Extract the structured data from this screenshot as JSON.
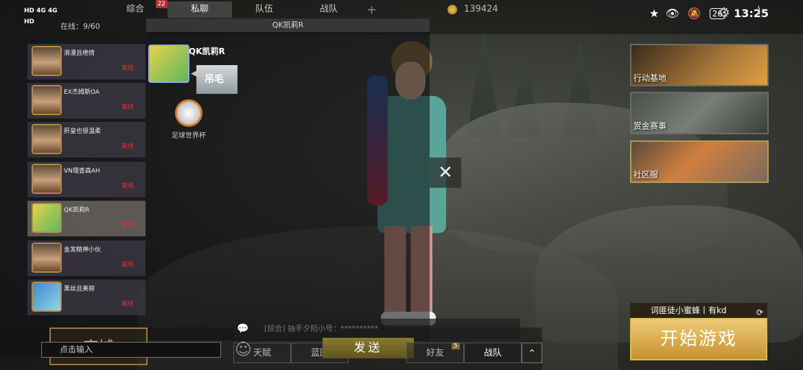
{
  "status_bar": {
    "left_lines": [
      "HD 4G 4G",
      "HD"
    ],
    "battery": "26",
    "time": "13:25"
  },
  "tabs": [
    {
      "label": "综合",
      "badge": "22"
    },
    {
      "label": "私聊",
      "badge": ""
    },
    {
      "label": "队伍",
      "badge": ""
    },
    {
      "label": "战队",
      "badge": ""
    }
  ],
  "currency": {
    "amount": "139424"
  },
  "online_text": "在线：9/60",
  "friends": [
    {
      "name": "浪漫且绝情",
      "status": "离线"
    },
    {
      "name": "EX杰姆斯OA",
      "status": "离线"
    },
    {
      "name": "肝皇也很温柔",
      "status": "离线"
    },
    {
      "name": "VN理查森AH",
      "status": "离线"
    },
    {
      "name": "QK凯莉R",
      "status": "离线"
    },
    {
      "name": "金发精神小伙",
      "status": "离线"
    },
    {
      "name": "黑丝且美丽",
      "status": "离线"
    }
  ],
  "chat": {
    "title": "QK凯莉R",
    "sender": "QK凯莉R",
    "message": "吊毛",
    "badge_label": "足球世界杯"
  },
  "close_icon": "close-icon",
  "right_menu": [
    {
      "label": "行动基地",
      "color": "#7a5a30"
    },
    {
      "label": "赏金赛事",
      "color": "#5a5e58"
    },
    {
      "label": "社区服",
      "color": "#6a5a4a"
    }
  ],
  "message_preview": "[综合] 抽手夕阳小号：**********",
  "bottom": {
    "shop_label": "商城",
    "input_placeholder": "点击输入",
    "send_label": "发送",
    "nav": [
      "天赋",
      "蓝图",
      "",
      "好友",
      "战队"
    ],
    "friends_badge": "5"
  },
  "team": {
    "name": "词匪徒小蜜蜂丨有kd"
  },
  "start_label": "开始游戏"
}
